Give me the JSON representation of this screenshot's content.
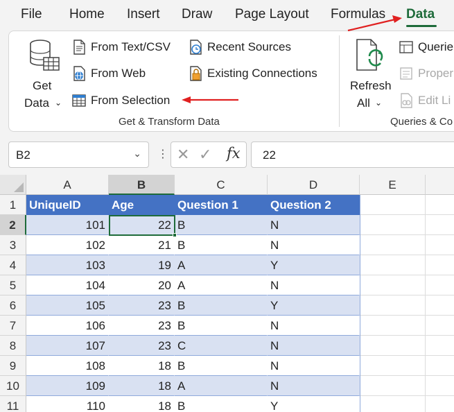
{
  "menu": {
    "tabs": [
      "File",
      "Home",
      "Insert",
      "Draw",
      "Page Layout",
      "Formulas",
      "Data"
    ],
    "active_tab": "Data"
  },
  "ribbon": {
    "get_data": {
      "line1": "Get",
      "line2": "Data"
    },
    "from_text_csv": "From Text/CSV",
    "from_web": "From Web",
    "from_selection": "From Selection",
    "recent_sources": "Recent Sources",
    "existing_connections": "Existing Connections",
    "group_get_transform": "Get & Transform Data",
    "refresh": {
      "line1": "Refresh",
      "line2": "All"
    },
    "queries": "Querie",
    "properties": "Proper",
    "edit_links": "Edit Li",
    "group_queries": "Queries & Co"
  },
  "formula_bar": {
    "name_box": "B2",
    "fx": "fx",
    "value": "22"
  },
  "sheet": {
    "columns": [
      "A",
      "B",
      "C",
      "D",
      "E"
    ],
    "selected_column": "B",
    "rows": [
      "1",
      "2",
      "3",
      "4",
      "5",
      "6",
      "7",
      "8",
      "9",
      "10",
      "11"
    ],
    "selected_row": "2",
    "table": {
      "headers": [
        "UniqueID",
        "Age",
        "Question 1",
        "Question 2"
      ],
      "rows": [
        [
          "101",
          "22",
          "B",
          "N"
        ],
        [
          "102",
          "21",
          "B",
          "N"
        ],
        [
          "103",
          "19",
          "A",
          "Y"
        ],
        [
          "104",
          "20",
          "A",
          "N"
        ],
        [
          "105",
          "23",
          "B",
          "Y"
        ],
        [
          "106",
          "23",
          "B",
          "N"
        ],
        [
          "107",
          "23",
          "C",
          "N"
        ],
        [
          "108",
          "18",
          "B",
          "N"
        ],
        [
          "109",
          "18",
          "A",
          "N"
        ],
        [
          "110",
          "18",
          "B",
          "Y"
        ]
      ]
    }
  },
  "colors": {
    "accent_green": "#1e6b3a",
    "table_header_blue": "#4472c4",
    "table_band_blue": "#d9e1f2",
    "annotation_red": "#e02020"
  }
}
